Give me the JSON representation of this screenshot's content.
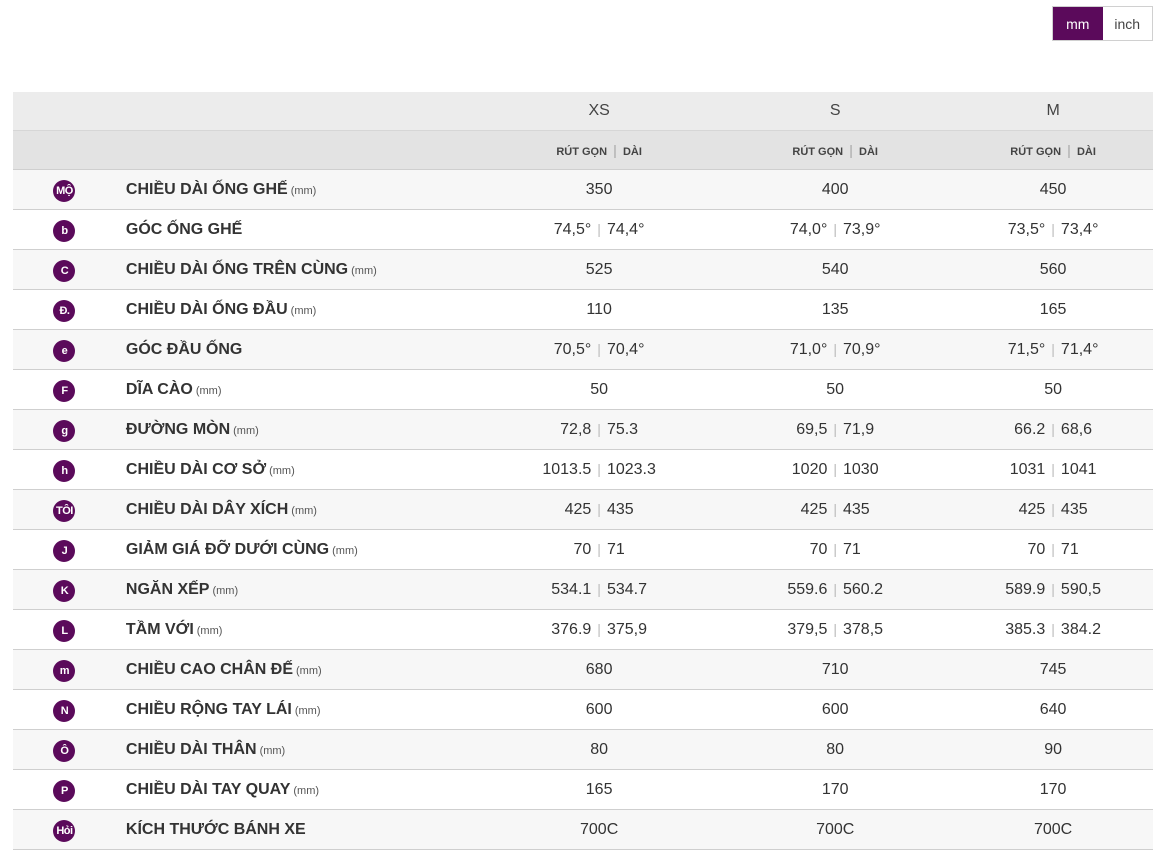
{
  "units": {
    "mm": "mm",
    "inch": "inch"
  },
  "sizes": [
    "XS",
    "S",
    "M"
  ],
  "sub_header": {
    "short": "RÚT GỌN",
    "long": "DÀI"
  },
  "rows": [
    {
      "badge": "MỘ",
      "label": "CHIỀU DÀI ỐNG GHẾ",
      "unit": "(mm)",
      "xs": [
        "350"
      ],
      "s": [
        "400"
      ],
      "m": [
        "450"
      ]
    },
    {
      "badge": "b",
      "label": "GÓC ỐNG GHẾ",
      "unit": "",
      "xs": [
        "74,5°",
        "74,4°"
      ],
      "s": [
        "74,0°",
        "73,9°"
      ],
      "m": [
        "73,5°",
        "73,4°"
      ]
    },
    {
      "badge": "C",
      "label": "CHIỀU DÀI ỐNG TRÊN CÙNG",
      "unit": "(mm)",
      "xs": [
        "525"
      ],
      "s": [
        "540"
      ],
      "m": [
        "560"
      ]
    },
    {
      "badge": "Đ.",
      "label": "CHIỀU DÀI ỐNG ĐẦU",
      "unit": "(mm)",
      "xs": [
        "110"
      ],
      "s": [
        "135"
      ],
      "m": [
        "165"
      ]
    },
    {
      "badge": "e",
      "label": "GÓC ĐẦU ỐNG",
      "unit": "",
      "xs": [
        "70,5°",
        "70,4°"
      ],
      "s": [
        "71,0°",
        "70,9°"
      ],
      "m": [
        "71,5°",
        "71,4°"
      ]
    },
    {
      "badge": "F",
      "label": "DĨA CÀO",
      "unit": "(mm)",
      "xs": [
        "50"
      ],
      "s": [
        "50"
      ],
      "m": [
        "50"
      ]
    },
    {
      "badge": "g",
      "label": "ĐƯỜNG MÒN",
      "unit": "(mm)",
      "xs": [
        "72,8",
        "75.3"
      ],
      "s": [
        "69,5",
        "71,9"
      ],
      "m": [
        "66.2",
        "68,6"
      ]
    },
    {
      "badge": "h",
      "label": "CHIỀU DÀI CƠ SỞ",
      "unit": "(mm)",
      "xs": [
        "1013.5",
        "1023.3"
      ],
      "s": [
        "1020",
        "1030"
      ],
      "m": [
        "1031",
        "1041"
      ]
    },
    {
      "badge": "TÔI",
      "label": "CHIỀU DÀI DÂY XÍCH",
      "unit": "(mm)",
      "xs": [
        "425",
        "435"
      ],
      "s": [
        "425",
        "435"
      ],
      "m": [
        "425",
        "435"
      ]
    },
    {
      "badge": "J",
      "label": "GIẢM GIÁ ĐỠ DƯỚI CÙNG",
      "unit": "(mm)",
      "xs": [
        "70",
        "71"
      ],
      "s": [
        "70",
        "71"
      ],
      "m": [
        "70",
        "71"
      ]
    },
    {
      "badge": "K",
      "label": "NGĂN XẾP",
      "unit": "(mm)",
      "xs": [
        "534.1",
        "534.7"
      ],
      "s": [
        "559.6",
        "560.2"
      ],
      "m": [
        "589.9",
        "590,5"
      ]
    },
    {
      "badge": "L",
      "label": "TẦM VỚI",
      "unit": "(mm)",
      "xs": [
        "376.9",
        "375,9"
      ],
      "s": [
        "379,5",
        "378,5"
      ],
      "m": [
        "385.3",
        "384.2"
      ]
    },
    {
      "badge": "m",
      "label": "CHIỀU CAO CHÂN ĐẾ",
      "unit": "(mm)",
      "xs": [
        "680"
      ],
      "s": [
        "710"
      ],
      "m": [
        "745"
      ]
    },
    {
      "badge": "N",
      "label": "CHIỀU RỘNG TAY LÁI",
      "unit": "(mm)",
      "xs": [
        "600"
      ],
      "s": [
        "600"
      ],
      "m": [
        "640"
      ]
    },
    {
      "badge": "Ô",
      "label": "CHIỀU DÀI THÂN",
      "unit": "(mm)",
      "xs": [
        "80"
      ],
      "s": [
        "80"
      ],
      "m": [
        "90"
      ]
    },
    {
      "badge": "P",
      "label": "CHIỀU DÀI TAY QUAY",
      "unit": "(mm)",
      "xs": [
        "165"
      ],
      "s": [
        "170"
      ],
      "m": [
        "170"
      ]
    },
    {
      "badge": "Hỏi",
      "label": "KÍCH THƯỚC BÁNH XE",
      "unit": "",
      "xs": [
        "700C"
      ],
      "s": [
        "700C"
      ],
      "m": [
        "700C"
      ]
    }
  ],
  "colors": {
    "accent": "#5b0a5b",
    "header_bg": "#ececec",
    "subheader_bg": "#e3e3e3",
    "row_alt": "#f7f7f7"
  }
}
